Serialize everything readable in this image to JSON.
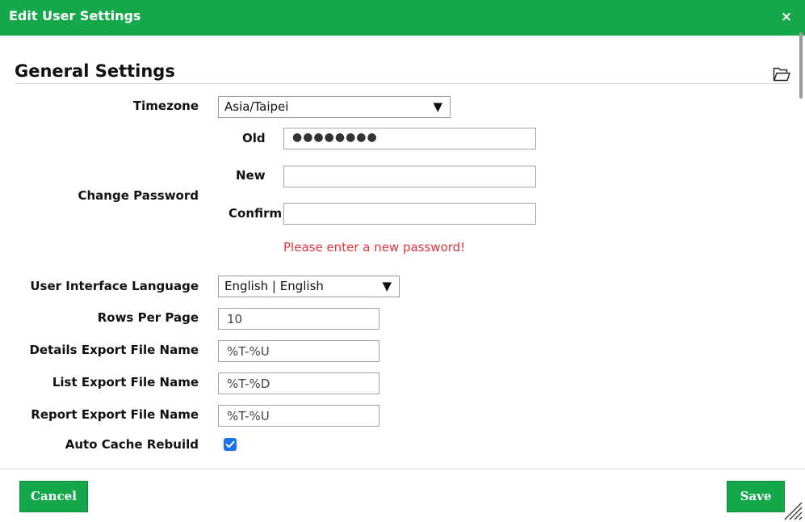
{
  "dialog": {
    "title": "Edit User Settings",
    "close_glyph": "×"
  },
  "section": {
    "title": "General Settings",
    "icon": "folder-icon"
  },
  "timezone": {
    "label": "Timezone",
    "value": "Asia/Taipei"
  },
  "password": {
    "label": "Change Password",
    "old_label": "Old",
    "old_value": "●●●●●●●●",
    "new_label": "New",
    "new_value": "",
    "confirm_label": "Confirm",
    "confirm_value": "",
    "error": "Please enter a new password!"
  },
  "language": {
    "label": "User Interface Language",
    "value": "English | English"
  },
  "rows_per_page": {
    "label": "Rows Per Page",
    "value": "10"
  },
  "details_export": {
    "label": "Details Export File Name",
    "value": "%T-%U"
  },
  "list_export": {
    "label": "List Export File Name",
    "value": "%T-%D"
  },
  "report_export": {
    "label": "Report Export File Name",
    "value": "%T-%U"
  },
  "auto_cache": {
    "label": "Auto Cache Rebuild",
    "checked": true
  },
  "footer": {
    "cancel_label": "Cancel",
    "save_label": "Save"
  },
  "colors": {
    "brand": "#14a84b",
    "error": "#e1333a",
    "checkbox": "#1a73e8"
  }
}
